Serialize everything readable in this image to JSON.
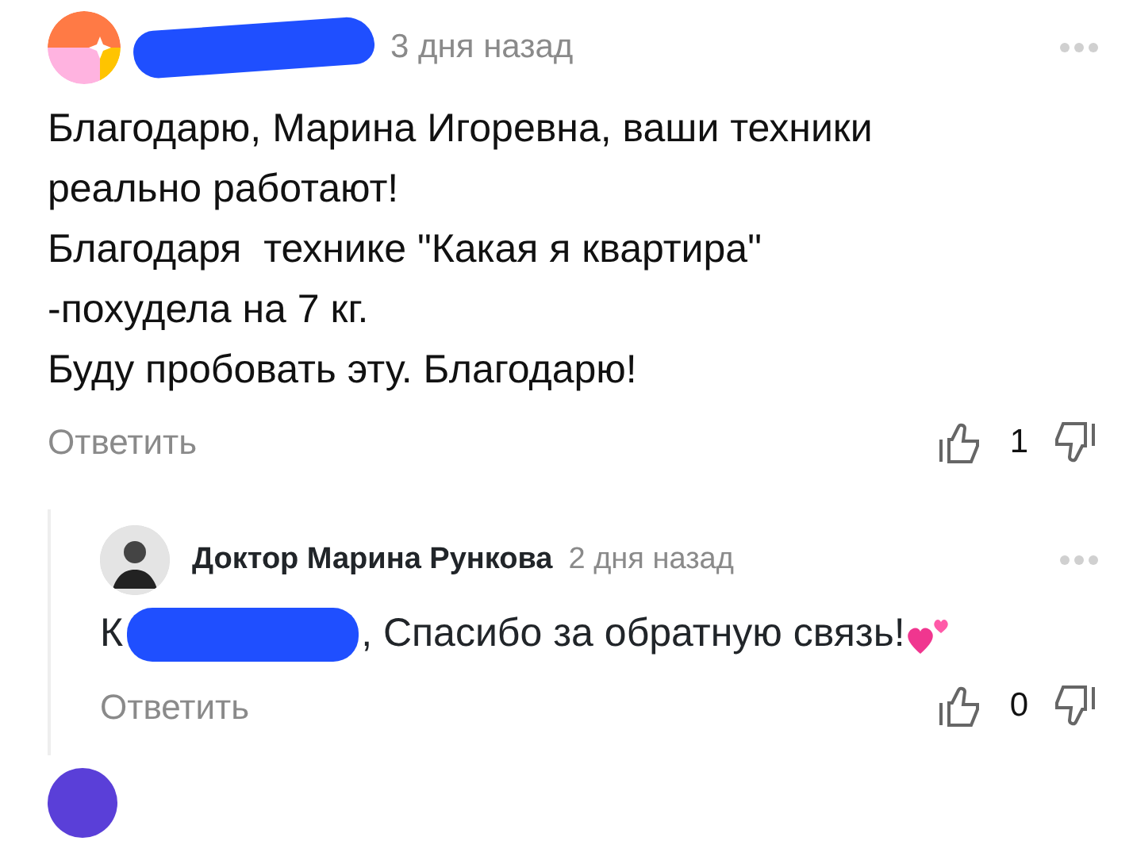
{
  "comment": {
    "time": "3 дня назад",
    "lines": [
      "Благодарю, Марина Игоревна, ваши техники",
      "реально работают!",
      "Благодаря  технике \"Какая я квартира\"",
      "-похудела на 7 кг.",
      "Буду пробовать эту. Благодарю!"
    ],
    "reply_label": "Ответить",
    "likes": "1",
    "reply": {
      "author": "Доктор Марина Рункова",
      "time": "2 дня назад",
      "text_start": "К",
      "text_end": ", Спасибо за обратную связь!",
      "reply_label": "Ответить",
      "likes": "0"
    }
  }
}
